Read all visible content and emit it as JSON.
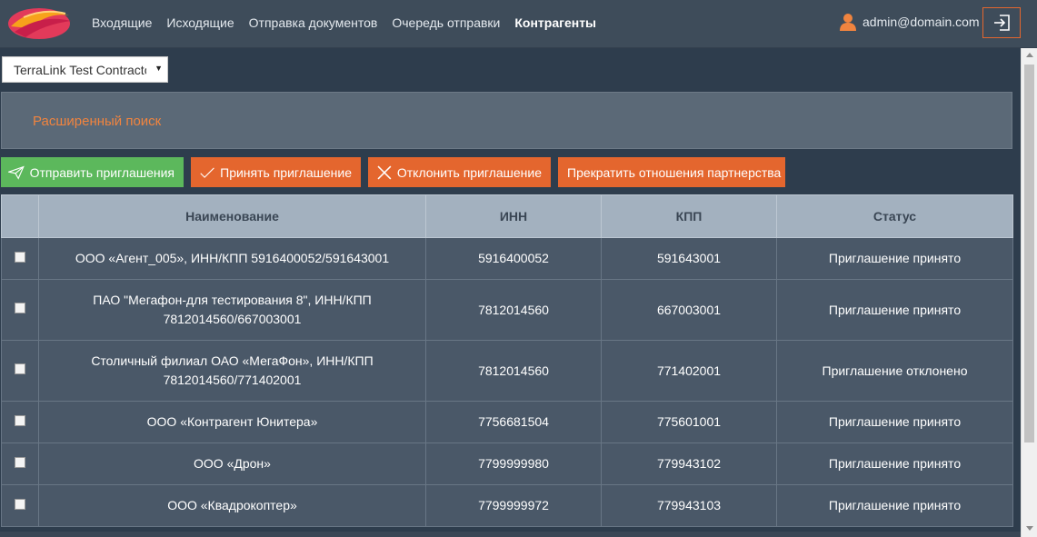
{
  "header": {
    "nav": [
      "Входящие",
      "Исходящие",
      "Отправка документов",
      "Очередь отправки",
      "Контрагенты"
    ],
    "active_nav": "Контрагенты",
    "user": "admin@domain.com",
    "logout_icon": "logout-icon",
    "user_icon": "user-icon"
  },
  "select": {
    "value": "TerraLink Test Contractor"
  },
  "advanced_search": {
    "label": "Расширенный поиск"
  },
  "actions": {
    "send": "Отправить приглашения",
    "accept": "Принять приглашение",
    "decline": "Отклонить приглашение",
    "stop": "Прекратить отношения партнерства"
  },
  "table": {
    "columns": [
      "Наименование",
      "ИНН",
      "КПП",
      "Статус"
    ],
    "rows": [
      {
        "name": "ООО «Агент_005», ИНН/КПП 5916400052/591643001",
        "inn": "5916400052",
        "kpp": "591643001",
        "status": "Приглашение принято"
      },
      {
        "name": "ПАО \"Мегафон-для тестирования 8\", ИНН/КПП 7812014560/667003001",
        "inn": "7812014560",
        "kpp": "667003001",
        "status": "Приглашение принято"
      },
      {
        "name": "Столичный филиал ОАО «МегаФон», ИНН/КПП 7812014560/771402001",
        "inn": "7812014560",
        "kpp": "771402001",
        "status": "Приглашение отклонено"
      },
      {
        "name": "ООО «Контрагент Юнитера»",
        "inn": "7756681504",
        "kpp": "775601001",
        "status": "Приглашение принято"
      },
      {
        "name": "ООО «Дрон»",
        "inn": "7799999980",
        "kpp": "779943102",
        "status": "Приглашение принято"
      },
      {
        "name": "ООО «Квадрокоптер»",
        "inn": "7799999972",
        "kpp": "779943103",
        "status": "Приглашение принято"
      }
    ]
  },
  "colors": {
    "topbar": "#3e4c5a",
    "accent_orange": "#e4662e",
    "send_green": "#5cb85c",
    "row_bg": "#4a5868",
    "header_bg": "#a3b1bf"
  }
}
